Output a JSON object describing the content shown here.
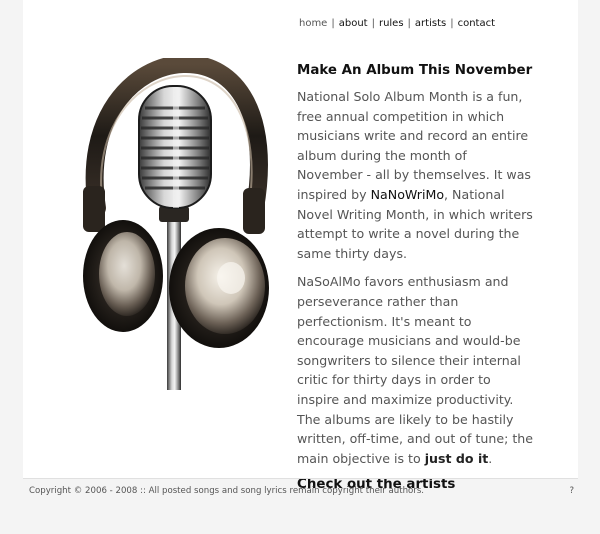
{
  "nav": {
    "items": [
      {
        "label": "home"
      },
      {
        "label": "about"
      },
      {
        "label": "rules"
      },
      {
        "label": "artists"
      },
      {
        "label": "contact"
      }
    ],
    "separator": "|"
  },
  "main": {
    "title": "Make An Album This November",
    "para1_before_link": "National Solo Album Month is a fun, free annual competition in which musicians write and record an entire album during the month of November - all by themselves. It was inspired by ",
    "para1_link": "NaNoWriMo",
    "para1_after_link": ", National Novel Writing Month, in which writers attempt to write a novel during the same thirty days.",
    "para2_before_strong": "NaSoAlMo favors enthusiasm and perseverance rather than perfectionism. It's meant to encourage musicians and would-be songwriters to silence their internal critic for thirty days in order to inspire and maximize productivity. The albums are likely to be hastily written, off-time, and out of tune; the main objective is to ",
    "para2_strong": "just do it",
    "para2_after_strong": ".",
    "cta": "Check out the artists"
  },
  "hero": {
    "icon": "headphones-microphone-image"
  },
  "footer": {
    "copyright": "Copyright © 2006 - 2008 :: All posted songs and song lyrics remain copyright their authors.",
    "help": "?"
  }
}
